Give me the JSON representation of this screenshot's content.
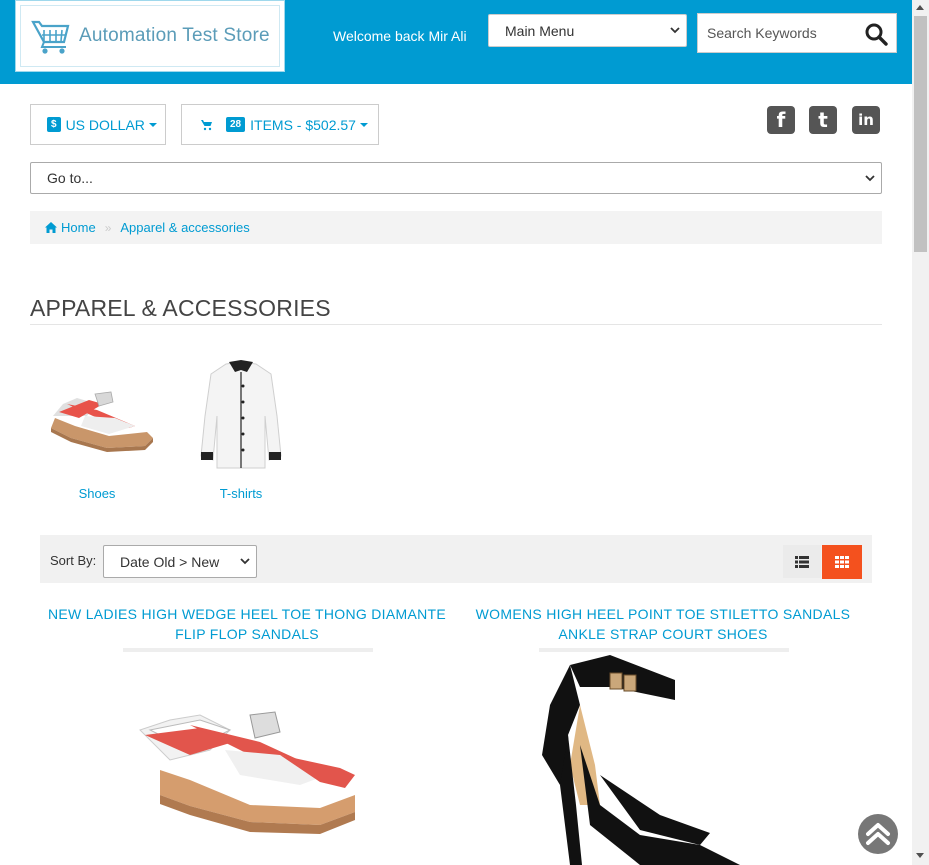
{
  "header": {
    "store_name": "Automation Test Store",
    "welcome": "Welcome back Mir Ali",
    "main_menu": "Main Menu",
    "search_placeholder": "Search Keywords",
    "bg_color": "#009bd2"
  },
  "currency": {
    "symbol": "$",
    "label": "US DOLLAR"
  },
  "cart": {
    "count": "28",
    "label": "ITEMS - $502.57"
  },
  "social": {
    "facebook": "f",
    "twitter": "t",
    "linkedin": "in"
  },
  "goto": {
    "label": "Go to..."
  },
  "breadcrumb": {
    "home": "Home",
    "current": "Apparel & accessories"
  },
  "page": {
    "title": "APPAREL & ACCESSORIES"
  },
  "subcategories": [
    {
      "label": "Shoes"
    },
    {
      "label": "T-shirts"
    }
  ],
  "sort": {
    "label": "Sort By:",
    "value": "Date Old > New"
  },
  "products": [
    {
      "title_line1": "NEW LADIES HIGH WEDGE HEEL TOE THONG DIAMANTE",
      "title_line2": "FLIP FLOP SANDALS"
    },
    {
      "title_line1": "WOMENS HIGH HEEL POINT TOE STILETTO SANDALS",
      "title_line2": "ANKLE STRAP COURT SHOES"
    }
  ],
  "colors": {
    "accent": "#009bd2",
    "active_view": "#f4511e"
  }
}
